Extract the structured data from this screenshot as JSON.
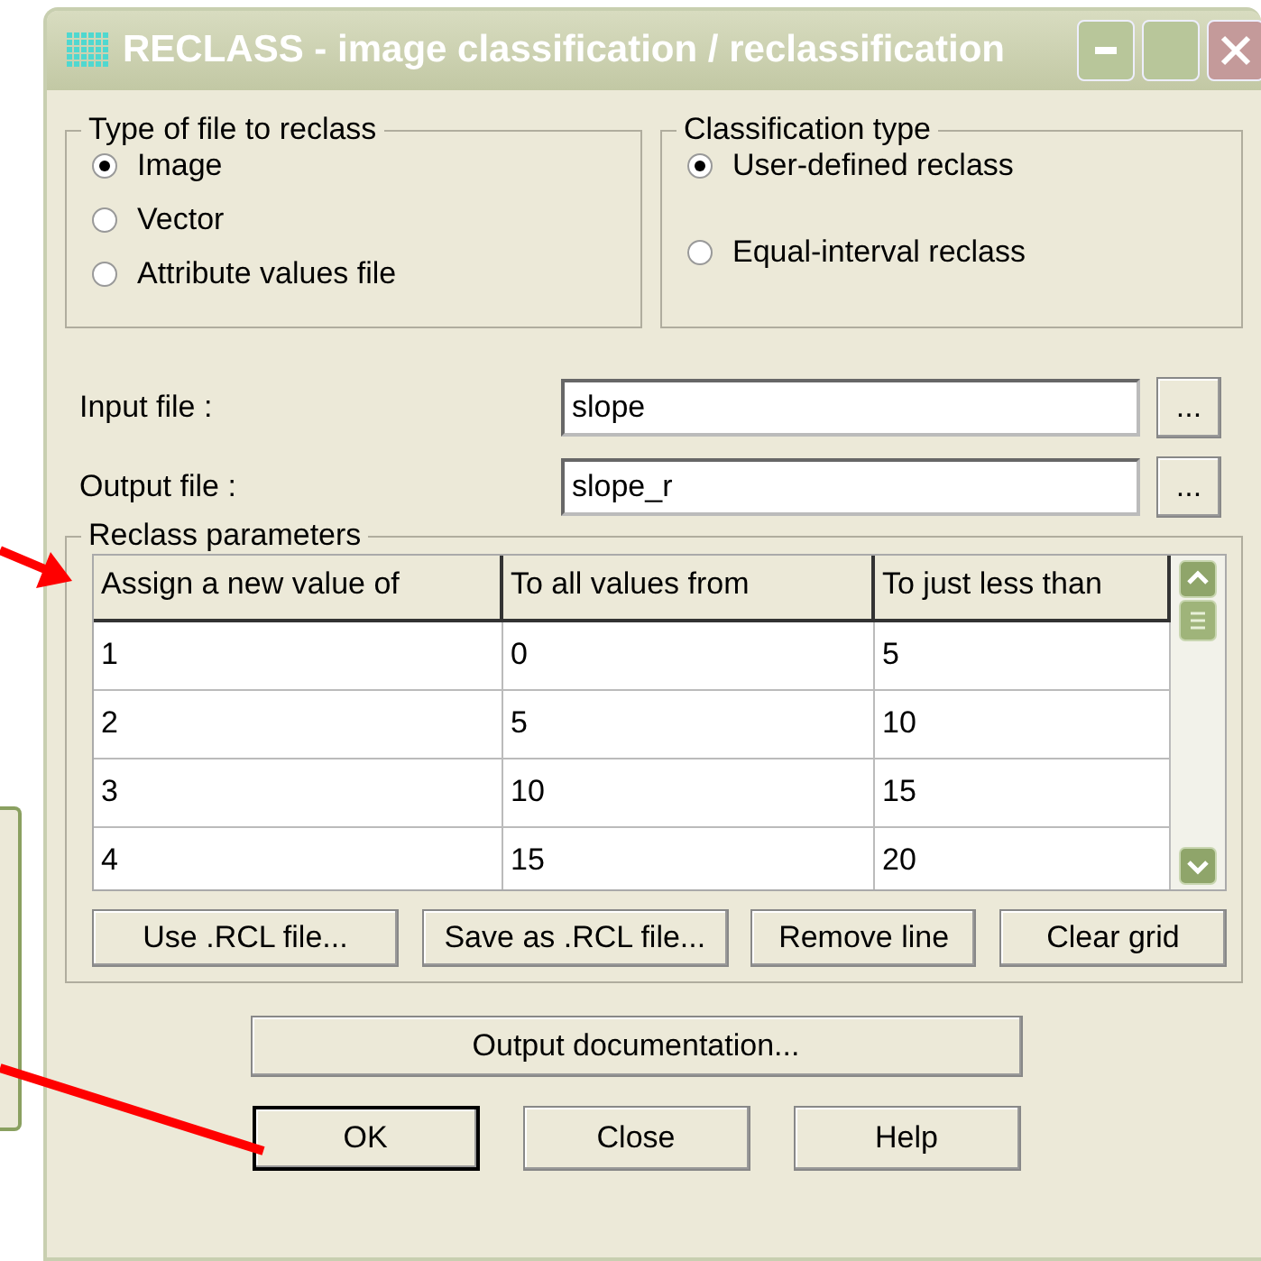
{
  "window": {
    "title": "RECLASS - image classification / reclassification"
  },
  "file_type": {
    "label": "Type of file to reclass",
    "options": [
      {
        "label": "Image",
        "selected": true
      },
      {
        "label": "Vector",
        "selected": false
      },
      {
        "label": "Attribute values file",
        "selected": false
      }
    ]
  },
  "classification_type": {
    "label": "Classification type",
    "options": [
      {
        "label": "User-defined reclass",
        "selected": true
      },
      {
        "label": "Equal-interval reclass",
        "selected": false
      }
    ]
  },
  "files": [
    {
      "label": "Input file :",
      "value": "slope",
      "browse": "..."
    },
    {
      "label": "Output file :",
      "value": "slope_r",
      "browse": "..."
    }
  ],
  "reclass_parameters": {
    "label": "Reclass parameters",
    "table": {
      "columns": [
        "Assign a new value of",
        "To all values from",
        "To just less than"
      ],
      "rows": [
        [
          "1",
          "0",
          "5"
        ],
        [
          "2",
          "5",
          "10"
        ],
        [
          "3",
          "10",
          "15"
        ],
        [
          "4",
          "15",
          "20"
        ]
      ]
    },
    "buttons": [
      "Use .RCL file...",
      "Save as .RCL file...",
      "Remove line",
      "Clear grid"
    ]
  },
  "documentation_button": "Output documentation...",
  "buttons": [
    {
      "label": "OK",
      "default": true
    },
    {
      "label": "Close",
      "default": false
    },
    {
      "label": "Help",
      "default": false
    }
  ]
}
